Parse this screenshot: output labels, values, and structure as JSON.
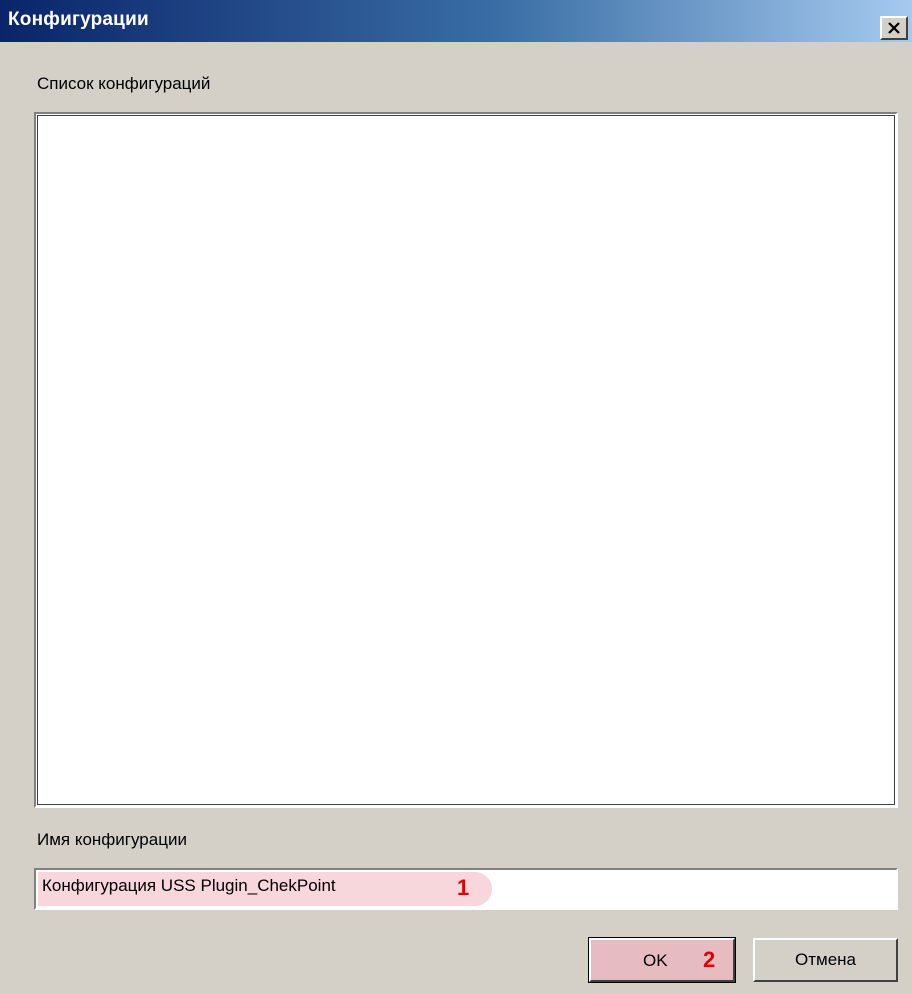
{
  "window": {
    "title": "Конфигурации",
    "close_glyph": "X"
  },
  "list": {
    "label": "Список конфигураций",
    "items": []
  },
  "name_field": {
    "label": "Имя конфигурации",
    "value": "Конфигурация USS Plugin_ChekPoint",
    "marker": "1"
  },
  "buttons": {
    "ok_label": "OK",
    "ok_marker": "2",
    "cancel_label": "Отмена"
  },
  "colors": {
    "titlebar_start": "#0a246a",
    "titlebar_end": "#a6caf0",
    "dialog_bg": "#d4d0c8",
    "highlight": "#f7d6dc",
    "marker": "#e00000"
  },
  "icons": {
    "close": "close-icon"
  }
}
